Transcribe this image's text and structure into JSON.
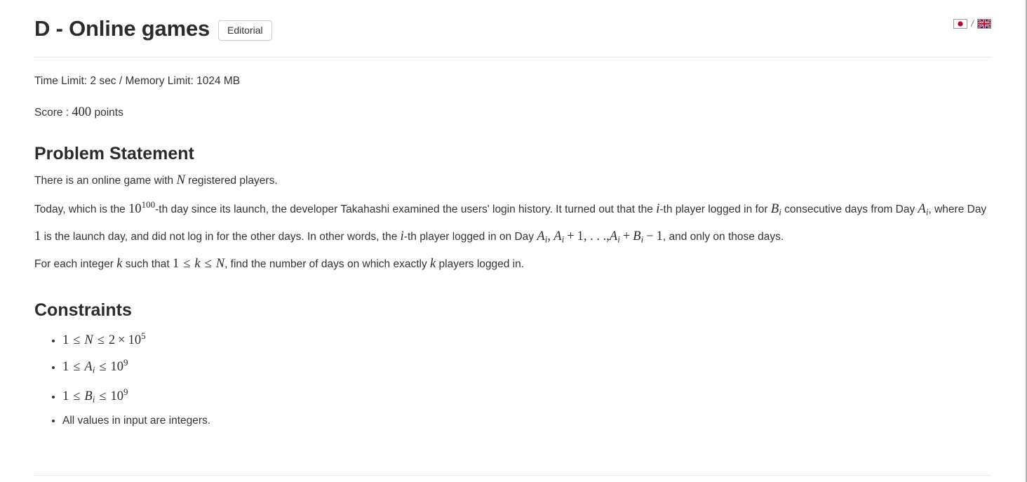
{
  "header": {
    "title": "D - Online games",
    "editorial_label": "Editorial",
    "lang": {
      "ja_flag_name": "japan-flag",
      "separator": "/",
      "en_flag_name": "uk-flag"
    }
  },
  "meta": {
    "limits": "Time Limit: 2 sec / Memory Limit: 1024 MB",
    "score_prefix": "Score :",
    "score_value": "400",
    "score_suffix": "points"
  },
  "problem_statement": {
    "heading": "Problem Statement",
    "line1_a": "There is an online game with",
    "line1_math_N": "N",
    "line1_b": "registered players.",
    "line2_a": "Today, which is the",
    "line2_math_base": "10",
    "line2_math_exp": "100",
    "line2_b": "-th day since its launch, the developer Takahashi examined the users' login history. It turned out that the",
    "line2_math_i": "i",
    "line2_c": "-th player logged in for",
    "line2_math_B": "B",
    "line2_math_B_sub": "i",
    "line3_a": "consecutive days from Day",
    "line3_math_A": "A",
    "line3_math_A_sub": "i",
    "line3_b": ", where Day",
    "line3_math_1": "1",
    "line3_c": "is the launch day, and did not log in for the other days. In other words, the",
    "line3_math_i": "i",
    "line3_d": "-th player logged in on Day",
    "line3_math_Ai": "A",
    "line3_math_Ai_sub": "i",
    "line3_math_Ai2": "A",
    "line3_math_Ai2_sub": "i",
    "line3_plus": "+",
    "line3_one": "1",
    "line4_ellipsis": ", . . .,",
    "line4_math_A": "A",
    "line4_math_A_sub": "i",
    "line4_plus": "+",
    "line4_math_B": "B",
    "line4_math_B_sub": "i",
    "line4_minus": "−",
    "line4_one": "1",
    "line4_tail": ", and only on those days.",
    "line5_a": "For each integer",
    "line5_math_k1": "k",
    "line5_b": "such that",
    "line5_math_1": "1",
    "line5_le1": "≤",
    "line5_math_k2": "k",
    "line5_le2": "≤",
    "line5_math_N": "N",
    "line5_c": ", find the number of days on which exactly",
    "line5_math_k3": "k",
    "line5_d": "players logged in."
  },
  "constraints": {
    "heading": "Constraints",
    "items": [
      {
        "type": "math",
        "parts": [
          "1",
          "≤",
          "N",
          "≤",
          "2",
          "×",
          "10",
          "5"
        ],
        "text": "1 ≤ N ≤ 2 × 10^5"
      },
      {
        "type": "math",
        "parts": [
          "1",
          "≤",
          "A",
          "i",
          "≤",
          "10",
          "9"
        ],
        "text": "1 ≤ A_i ≤ 10^9"
      },
      {
        "type": "math",
        "parts": [
          "1",
          "≤",
          "B",
          "i",
          "≤",
          "10",
          "9"
        ],
        "text": "1 ≤ B_i ≤ 10^9"
      },
      {
        "type": "text",
        "text": "All values in input are integers."
      }
    ]
  },
  "colors": {
    "text": "#333333",
    "heading": "#2b2b2b",
    "divider": "#e8e8e8",
    "button_border": "#cccccc",
    "math": "#2b2b2b"
  }
}
